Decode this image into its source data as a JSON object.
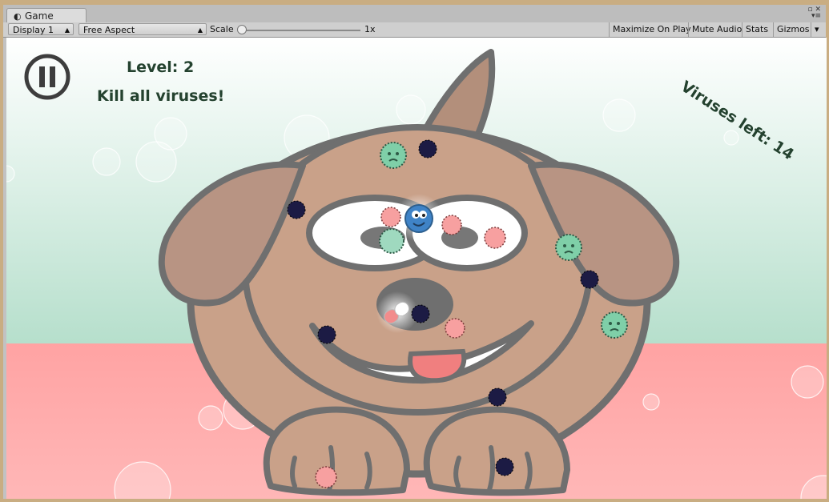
{
  "editor": {
    "tab_title": "Game",
    "tab_icon": "unity-icon",
    "toolbar": {
      "display": "Display 1",
      "aspect": "Free Aspect",
      "scale_label": "Scale",
      "scale_value": "1x",
      "maximize": "Maximize On Play",
      "mute": "Mute Audio",
      "stats": "Stats",
      "gizmos": "Gizmos"
    }
  },
  "hud": {
    "level": "Level: 2",
    "objective": "Kill all viruses!",
    "viruses_left": "Viruses left: 14"
  },
  "colors": {
    "sky_top": "#ffffff",
    "sky_bottom": "#b6dfcc",
    "floor": "#ffa6a6",
    "dog_fur": "#c8a088",
    "outline": "#6f6f6f",
    "virus_dark": "#1c1b44",
    "virus_green": "#7fcfa8",
    "virus_pink": "#f7a0a0",
    "hud_text": "#24422f"
  }
}
